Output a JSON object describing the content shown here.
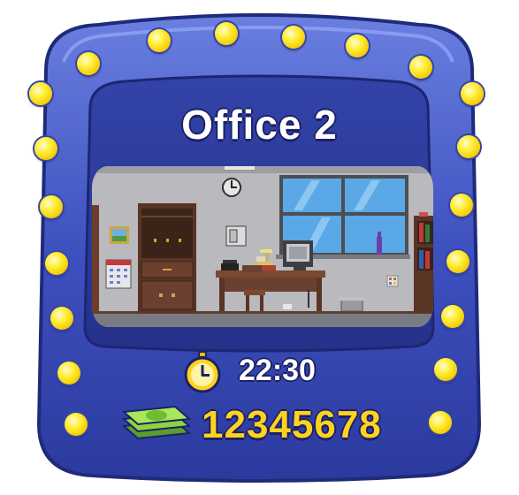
{
  "room": {
    "title": "Office 2"
  },
  "stats": {
    "time": "22:30",
    "money": "12345678"
  },
  "icons": {
    "time": "stopwatch-icon",
    "money": "cash-stack-icon"
  },
  "colors": {
    "frame_blue": "#3a4bb8",
    "frame_dark": "#26307e",
    "bulb_yellow": "#ffe23a",
    "money_yellow": "#ffd21e"
  }
}
